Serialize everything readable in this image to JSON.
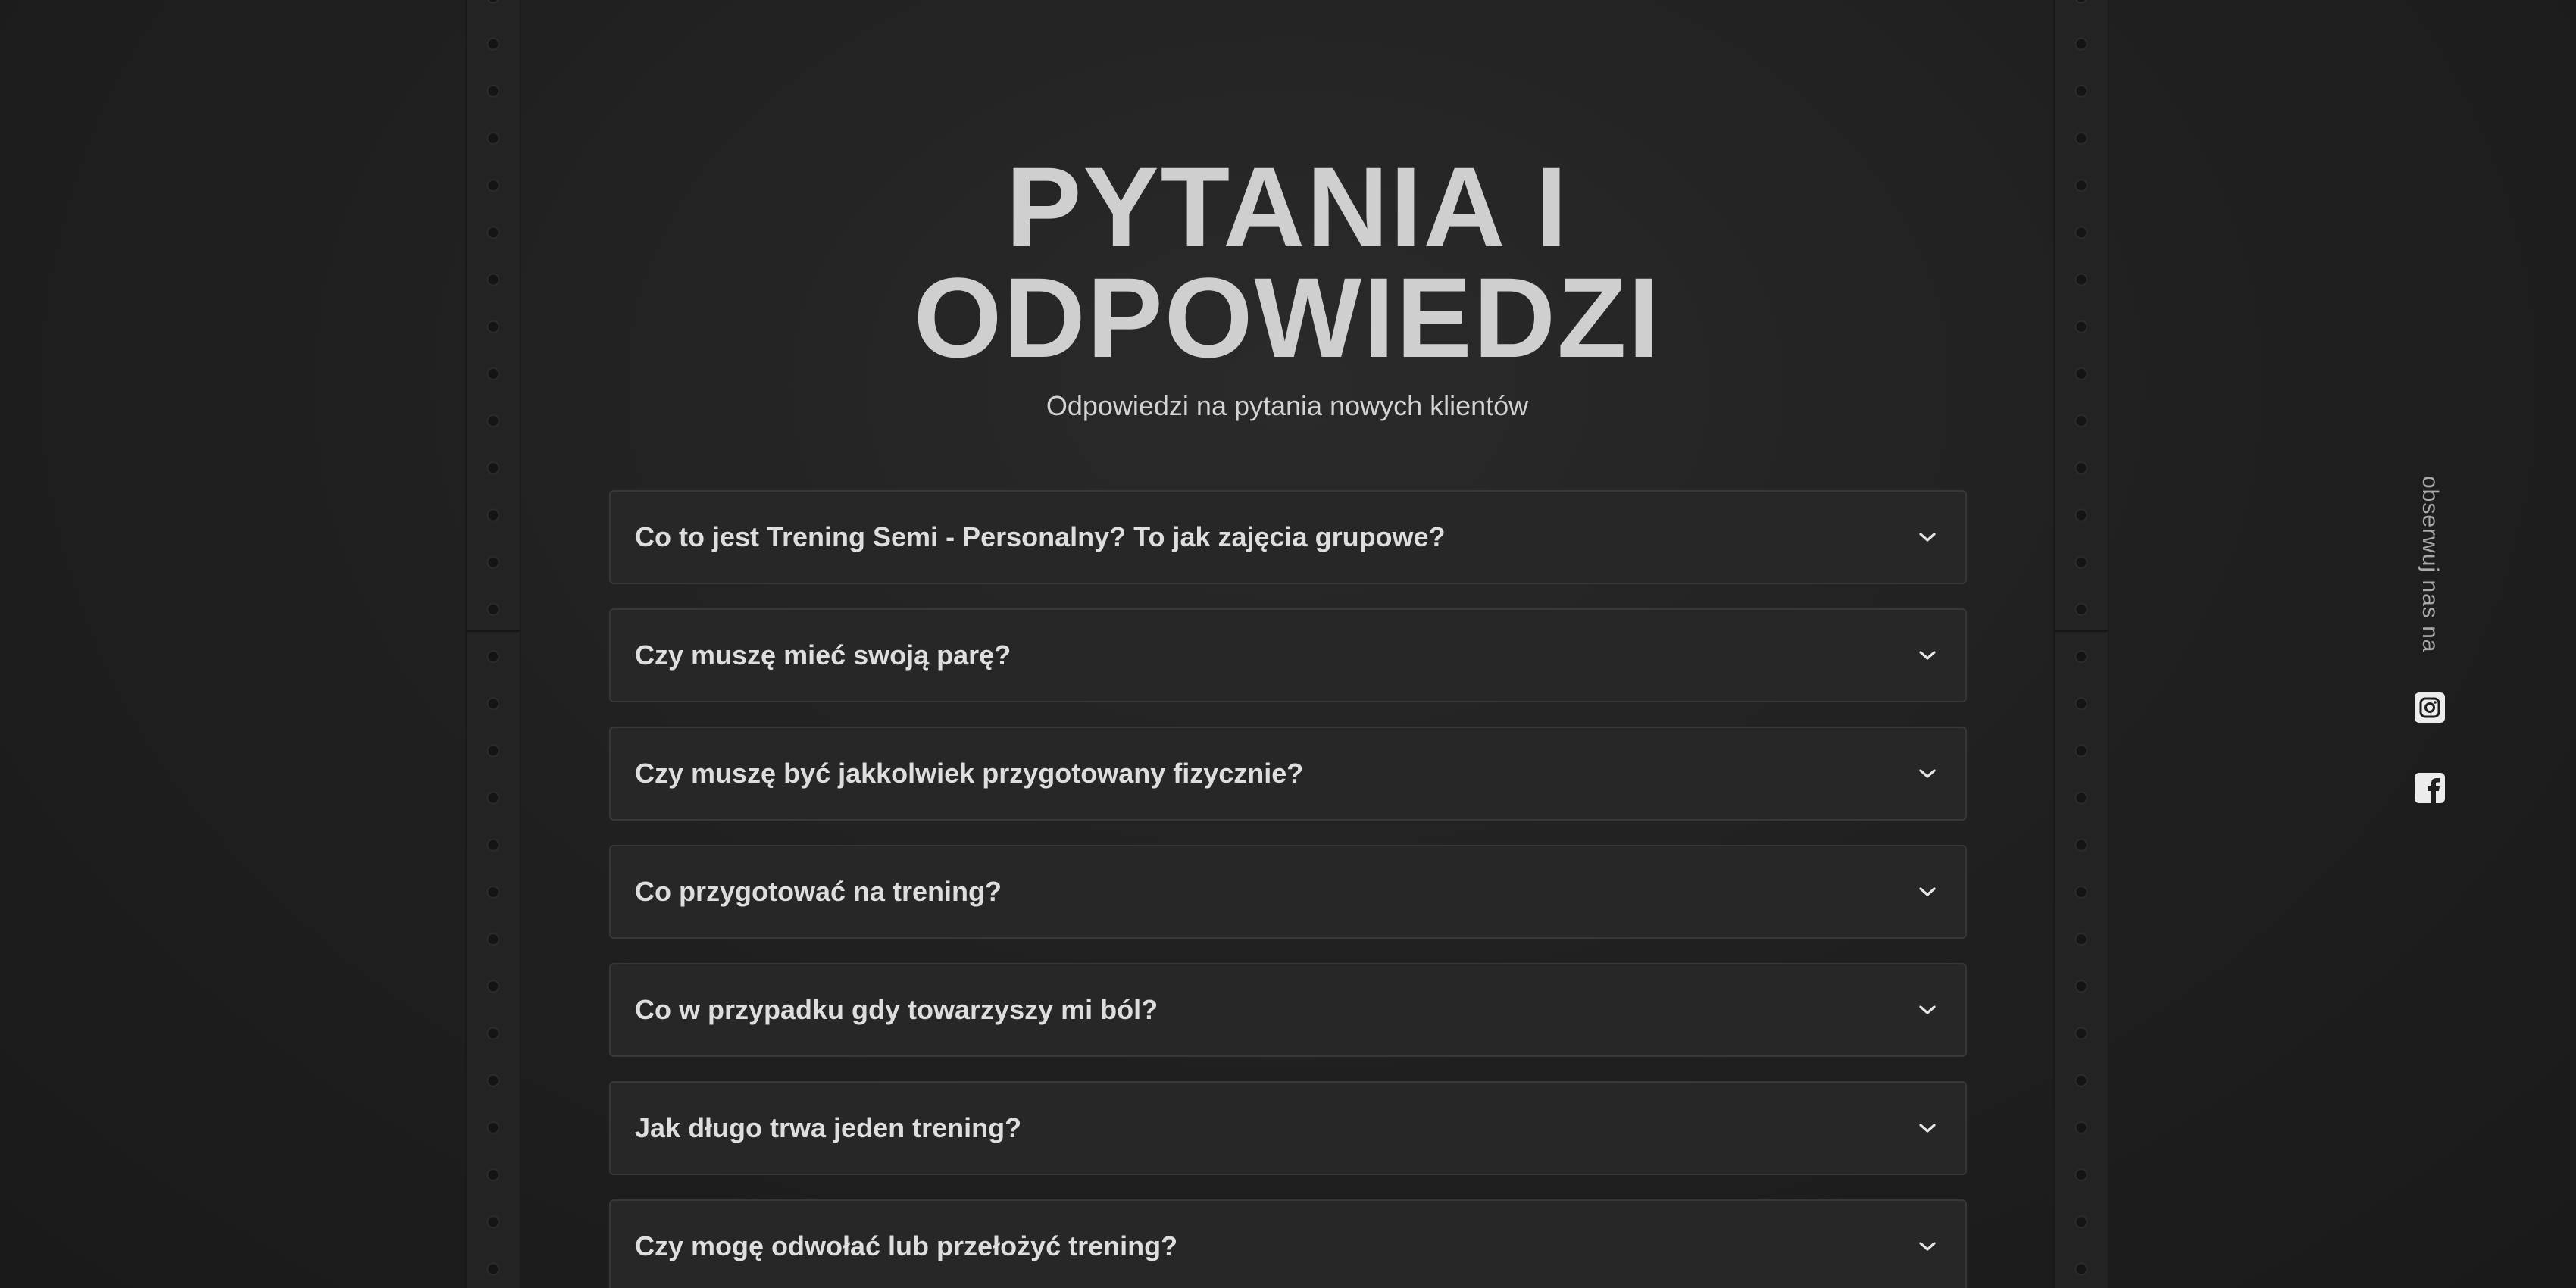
{
  "header": {
    "title_line1": "PYTANIA I",
    "title_line2": "ODPOWIEDZI",
    "subtitle": "Odpowiedzi na pytania nowych klientów"
  },
  "faq": {
    "items": [
      {
        "question": "Co to jest Trening Semi - Personalny? To jak zajęcia grupowe?"
      },
      {
        "question": "Czy muszę mieć swoją parę?"
      },
      {
        "question": "Czy muszę być jakkolwiek przygotowany fizycznie?"
      },
      {
        "question": "Co przygotować na trening?"
      },
      {
        "question": "Co w przypadku gdy towarzyszy mi ból?"
      },
      {
        "question": "Jak długo trwa jeden trening?"
      },
      {
        "question": "Czy mogę odwołać lub przełożyć trening?"
      }
    ],
    "expand_icon": "chevron-down-icon"
  },
  "social": {
    "label": "obserwuj nas na",
    "icons": [
      "instagram-icon",
      "facebook-icon"
    ]
  },
  "colors": {
    "background": "#1e1e1e",
    "card": "#272727",
    "card_border": "#383838",
    "title": "#cfcfcf",
    "text": "#dedede"
  }
}
